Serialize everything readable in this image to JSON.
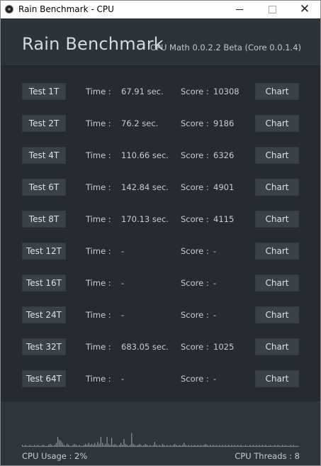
{
  "window": {
    "title": "Rain Benchmark - CPU"
  },
  "header": {
    "app_title": "Rain Benchmark",
    "version": "CPU Math 0.0.2.2 Beta (Core 0.0.1.4)"
  },
  "labels": {
    "time": "Time :",
    "score": "Score :",
    "chart": "Chart"
  },
  "tests": [
    {
      "name": "Test 1T",
      "time": "67.91 sec.",
      "score": "10308"
    },
    {
      "name": "Test 2T",
      "time": "76.2 sec.",
      "score": "9186"
    },
    {
      "name": "Test 4T",
      "time": "110.66 sec.",
      "score": "6326"
    },
    {
      "name": "Test 6T",
      "time": "142.84 sec.",
      "score": "4901"
    },
    {
      "name": "Test 8T",
      "time": "170.13 sec.",
      "score": "4115"
    },
    {
      "name": "Test 12T",
      "time": "-",
      "score": "-"
    },
    {
      "name": "Test 16T",
      "time": "-",
      "score": "-"
    },
    {
      "name": "Test 24T",
      "time": "-",
      "score": "-"
    },
    {
      "name": "Test 32T",
      "time": "683.05 sec.",
      "score": "1025"
    },
    {
      "name": "Test 64T",
      "time": "-",
      "score": "-"
    }
  ],
  "footer": {
    "cpu_usage": "CPU Usage : 2%",
    "cpu_threads": "CPU Threads : 8",
    "usage_history": [
      2,
      1,
      2,
      1,
      1,
      2,
      1,
      1,
      2,
      1,
      2,
      1,
      1,
      2,
      2,
      1,
      1,
      2,
      3,
      2,
      1,
      2,
      4,
      10,
      7,
      6,
      4,
      2,
      1,
      3,
      2,
      1,
      1,
      2,
      3,
      2,
      1,
      2,
      1,
      1,
      2,
      3,
      2,
      4,
      2,
      3,
      2,
      4,
      2,
      5,
      3,
      10,
      4,
      2,
      3,
      10,
      3,
      2,
      9,
      2,
      3,
      2,
      1,
      2,
      4,
      2,
      8,
      3,
      2,
      1,
      2,
      14,
      3,
      2,
      1,
      2,
      3,
      2,
      1,
      2,
      3,
      2,
      1,
      2,
      1,
      2,
      5,
      2,
      1,
      2,
      1,
      3,
      2,
      1,
      2,
      1,
      2,
      1,
      2,
      3,
      2,
      1,
      2,
      1,
      2,
      4,
      2,
      1,
      2,
      1,
      2,
      1,
      2,
      1,
      2,
      1,
      2,
      1,
      2,
      3,
      2,
      1,
      2,
      1,
      2,
      1,
      2,
      1,
      2,
      1,
      2,
      1,
      2,
      1,
      2,
      1,
      2,
      1,
      2,
      1,
      2,
      1,
      2,
      1,
      1,
      2,
      1,
      1,
      2,
      1,
      2,
      1,
      2,
      1,
      2,
      1,
      2,
      1,
      2,
      1,
      1,
      2,
      1,
      1,
      2,
      1,
      2,
      1,
      1,
      2,
      1,
      2,
      1,
      1,
      2,
      1,
      2,
      1,
      1,
      1
    ],
    "colors": {
      "bar": "#8d949b",
      "baseline": "#5f676e"
    }
  }
}
